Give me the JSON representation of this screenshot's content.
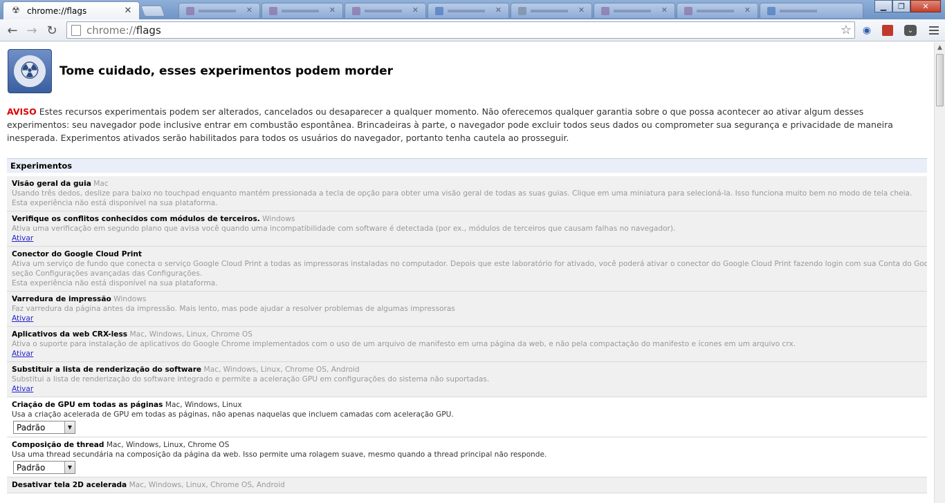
{
  "browser": {
    "active_tab": {
      "title": "chrome://flags"
    },
    "address": {
      "scheme": "chrome://",
      "host": "flags"
    }
  },
  "page": {
    "title": "Tome cuidado, esses experimentos podem morder",
    "warning_label": "AVISO",
    "warning_text": " Estes recursos experimentais podem ser alterados, cancelados ou desaparecer a qualquer momento. Não oferecemos qualquer garantia sobre o que possa acontecer ao ativar algum desses experimentos: seu navegador pode inclusive entrar em combustão espontânea. Brincadeiras à parte, o navegador pode excluir todos seus dados ou comprometer sua segurança e privacidade de maneira inesperada. Experimentos ativados serão habilitados para todos os usuários do navegador, portanto tenha cautela ao prosseguir.",
    "section_title": "Experimentos",
    "experiments": [
      {
        "name": "Visão geral da guia",
        "platforms": "Mac",
        "desc": "Usando três dedos, deslize para baixo no touchpad enquanto mantém pressionada a tecla de opção para obter uma visão geral de todas as suas guias. Clique em uma miniatura para selecioná-la. Isso funciona muito bem no modo de tela cheia.",
        "note": "Esta experiência não está disponível na sua plataforma."
      },
      {
        "name": "Verifique os conflitos conhecidos com módulos de terceiros.",
        "platforms": "Windows",
        "desc": "Ativa uma verificação em segundo plano que avisa você quando uma incompatibilidade com software é detectada (por ex., módulos de terceiros que causam falhas no navegador).",
        "link": "Ativar"
      },
      {
        "name": "Conector do Google Cloud Print",
        "platforms": "",
        "desc": "Ativa um serviço de fundo que conecta o serviço Google Cloud Print a todas as impressoras instaladas no computador. Depois que este laboratório for ativado, você poderá ativar o conector do Google Cloud Print fazendo login com sua Conta do Google na",
        "desc2": "seção Configurações avançadas das Configurações.",
        "note": "Esta experiência não está disponível na sua plataforma."
      },
      {
        "name": "Varredura de impressão",
        "platforms": "Windows",
        "desc": "Faz varredura da página antes da impressão. Mais lento, mas pode ajudar a resolver problemas de algumas impressoras",
        "link": "Ativar"
      },
      {
        "name": "Aplicativos da web CRX-less",
        "platforms": "Mac, Windows, Linux, Chrome OS",
        "desc": "Ativa o suporte para instalação de aplicativos do Google Chrome implementados com o uso de um arquivo de manifesto em uma página da web, e não pela compactação do manifesto e ícones em um arquivo crx.",
        "link": "Ativar"
      },
      {
        "name": "Substituir a lista de renderização do software",
        "platforms": "Mac, Windows, Linux, Chrome OS, Android",
        "desc": "Substitui a lista de renderização do software integrado e permite a aceleração GPU em configurações do sistema não suportadas.",
        "link": "Ativar"
      },
      {
        "name": "Criação de GPU em todas as páginas",
        "platforms": "Mac, Windows, Linux",
        "desc": "Usa a criação acelerada de GPU em todas as páginas, não apenas naquelas que incluem camadas com aceleração GPU.",
        "select": "Padrão"
      },
      {
        "name": "Composição de thread",
        "platforms": "Mac, Windows, Linux, Chrome OS",
        "desc": "Usa uma thread secundária na composição da página da web. Isso permite uma rolagem suave, mesmo quando a thread principal não responde.",
        "select": "Padrão"
      },
      {
        "name": "Desativar tela 2D acelerada",
        "platforms": "Mac, Windows, Linux, Chrome OS, Android"
      }
    ]
  }
}
